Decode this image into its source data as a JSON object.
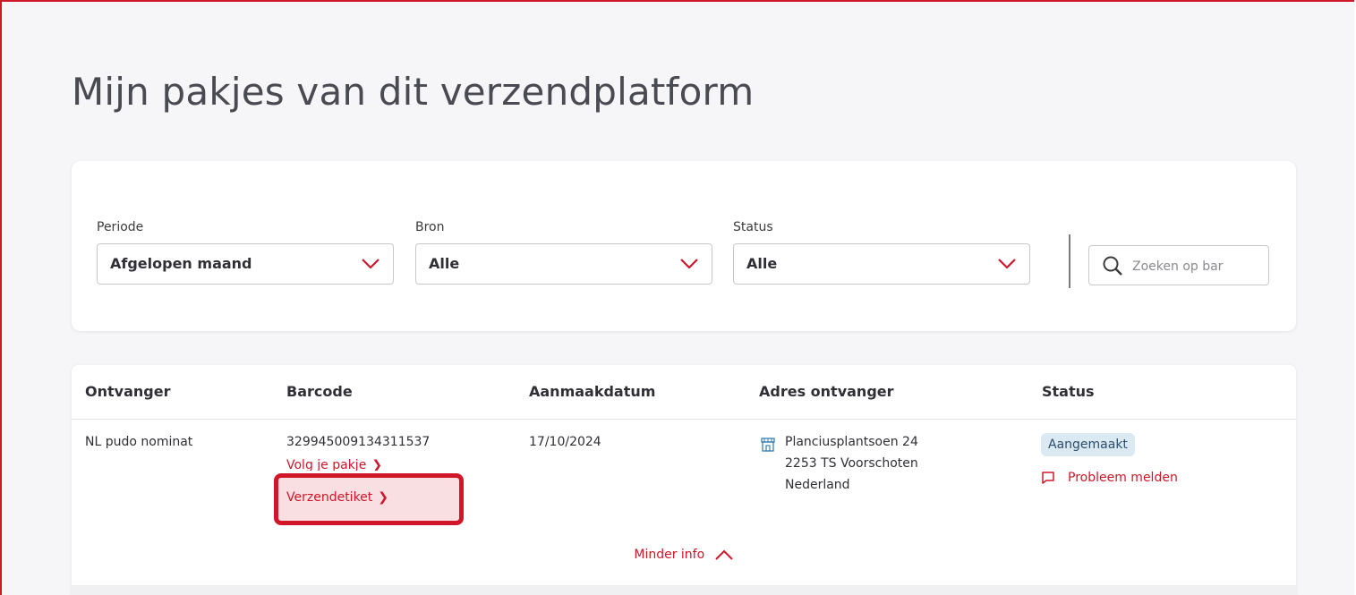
{
  "page": {
    "title": "Mijn pakjes van dit verzendplatform"
  },
  "filters": {
    "periode": {
      "label": "Periode",
      "value": "Afgelopen maand"
    },
    "bron": {
      "label": "Bron",
      "value": "Alle"
    },
    "status": {
      "label": "Status",
      "value": "Alle"
    },
    "search": {
      "placeholder": "Zoeken op bar"
    }
  },
  "table": {
    "headers": [
      "Ontvanger",
      "Barcode",
      "Aanmaakdatum",
      "Adres ontvanger",
      "Status"
    ],
    "row": {
      "recipient": "NL pudo nominat",
      "barcode": "329945009134311537",
      "track_link": "Volg je pakje",
      "label_link": "Verzendetiket",
      "date": "17/10/2024",
      "address": [
        "Planciusplantsoen 24",
        "2253 TS Voorschoten",
        "Nederland"
      ],
      "status": "Aangemaakt",
      "report_problem": "Probleem melden"
    },
    "less_info": "Minder info"
  },
  "colors": {
    "accent": "#d0172a",
    "badge_bg": "#dbe9f3",
    "title": "#4a4a52"
  },
  "icons": [
    "chevron-down-icon",
    "search-icon",
    "store-icon",
    "chat-bubble-icon",
    "chevron-right-icon",
    "chevron-up-icon"
  ]
}
